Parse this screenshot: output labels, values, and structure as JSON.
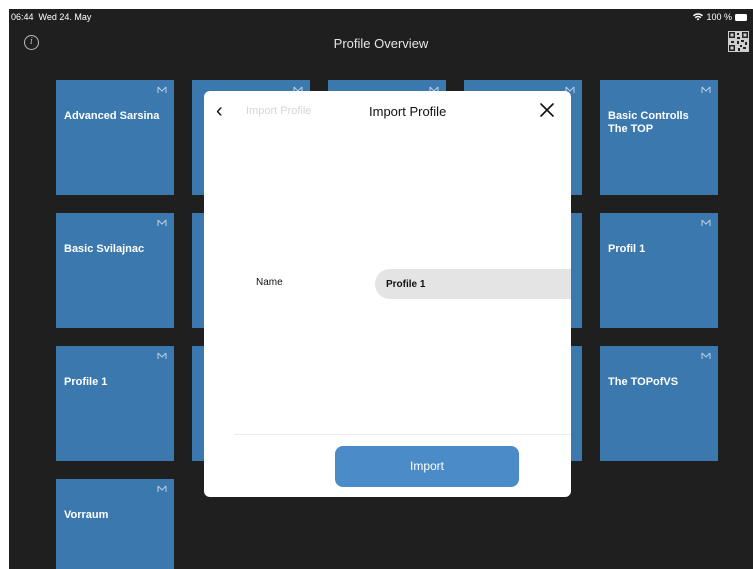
{
  "status_bar": {
    "time": "06:44",
    "date": "Wed 24. May",
    "battery": "100 %"
  },
  "header": {
    "title": "Profile Overview",
    "info_icon": "info-icon",
    "qr_icon": "qr-code-icon"
  },
  "tiles": [
    "Advanced Sarsina",
    "Basic Controlls\nThe TOP",
    "Basic Svilajnac",
    "Profil 1",
    "Profile 1",
    "The TOPofVS",
    "Vorraum"
  ],
  "modal": {
    "back_icon": "chevron-left-icon",
    "ghost_title": "Import Profile",
    "title": "Import Profile",
    "close_icon": "close-icon",
    "name_label": "Name",
    "name_value": "Profile 1",
    "import_label": "Import"
  },
  "colors": {
    "background": "#1f1f1f",
    "tile": "#3b78ae",
    "button": "#4a8bc8"
  }
}
